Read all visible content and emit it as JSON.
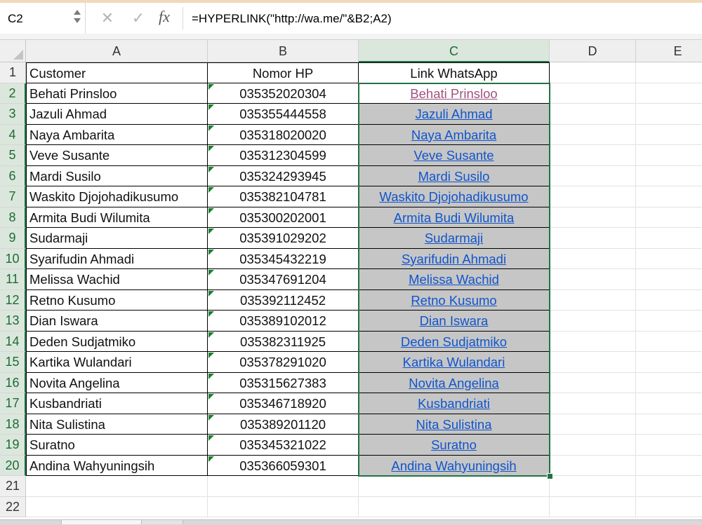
{
  "name_box": "C2",
  "formula": "=HYPERLINK(\"http://wa.me/\"&B2;A2)",
  "formula_icons": {
    "cancel": "x-icon",
    "confirm": "check-icon",
    "function": "fx-icon"
  },
  "columns": [
    "A",
    "B",
    "C",
    "D",
    "E"
  ],
  "selected_column": "C",
  "selected_cell": "C2",
  "headers": {
    "customer": "Customer",
    "phone": "Nomor HP",
    "link": "Link WhatsApp"
  },
  "rows": [
    {
      "num": "1"
    },
    {
      "num": "2",
      "customer": "Behati Prinsloo",
      "phone": "035352020304",
      "link": "Behati Prinsloo",
      "visited": true
    },
    {
      "num": "3",
      "customer": "Jazuli Ahmad",
      "phone": "035355444558",
      "link": "Jazuli Ahmad"
    },
    {
      "num": "4",
      "customer": "Naya Ambarita",
      "phone": "035318020020",
      "link": "Naya Ambarita"
    },
    {
      "num": "5",
      "customer": "Veve Susante",
      "phone": "035312304599",
      "link": "Veve Susante"
    },
    {
      "num": "6",
      "customer": "Mardi Susilo",
      "phone": "035324293945",
      "link": "Mardi Susilo"
    },
    {
      "num": "7",
      "customer": "Waskito Djojohadikusumo",
      "phone": "035382104781",
      "link": "Waskito Djojohadikusumo"
    },
    {
      "num": "8",
      "customer": "Armita Budi Wilumita",
      "phone": "035300202001",
      "link": "Armita Budi Wilumita"
    },
    {
      "num": "9",
      "customer": "Sudarmaji",
      "phone": "035391029202",
      "link": "Sudarmaji"
    },
    {
      "num": "10",
      "customer": "Syarifudin Ahmadi",
      "phone": "035345432219",
      "link": "Syarifudin Ahmadi"
    },
    {
      "num": "11",
      "customer": "Melissa Wachid",
      "phone": "035347691204",
      "link": "Melissa Wachid"
    },
    {
      "num": "12",
      "customer": "Retno Kusumo",
      "phone": "035392112452",
      "link": "Retno Kusumo"
    },
    {
      "num": "13",
      "customer": "Dian Iswara",
      "phone": "035389102012",
      "link": "Dian Iswara"
    },
    {
      "num": "14",
      "customer": "Deden Sudjatmiko",
      "phone": "035382311925",
      "link": "Deden Sudjatmiko"
    },
    {
      "num": "15",
      "customer": "Kartika Wulandari",
      "phone": "035378291020",
      "link": "Kartika Wulandari"
    },
    {
      "num": "16",
      "customer": "Novita Angelina",
      "phone": "035315627383",
      "link": "Novita Angelina"
    },
    {
      "num": "17",
      "customer": "Kusbandriati",
      "phone": "035346718920",
      "link": "Kusbandriati"
    },
    {
      "num": "18",
      "customer": "Nita Sulistina",
      "phone": "035389201120",
      "link": "Nita Sulistina"
    },
    {
      "num": "19",
      "customer": "Suratno",
      "phone": "035345321022",
      "link": "Suratno"
    },
    {
      "num": "20",
      "customer": "Andina Wahyuningsih",
      "phone": "035366059301",
      "link": "Andina Wahyuningsih"
    },
    {
      "num": "21"
    },
    {
      "num": "22"
    }
  ],
  "colors": {
    "accent": "#217346",
    "link": "#1155cc",
    "visited_link": "#a0527f",
    "range_fill": "#c6c6c6",
    "error_flag": "#1e7d32"
  }
}
